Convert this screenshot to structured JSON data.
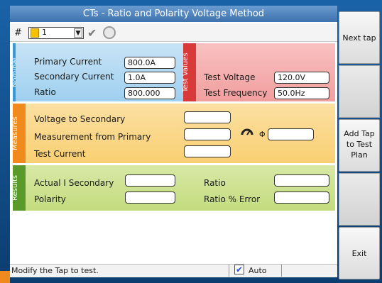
{
  "window": {
    "title": "CTs - Ratio and Polarity Voltage Method"
  },
  "toolbar": {
    "hash": "#",
    "tap_number": "1",
    "check_icon": "checkmark-icon",
    "refresh_icon": "circle-icon"
  },
  "nominal": {
    "tab": "Nominal",
    "primary_current_label": "Primary Current",
    "primary_current_value": "800.0A",
    "secondary_current_label": "Secondary Current",
    "secondary_current_value": "1.0A",
    "ratio_label": "Ratio",
    "ratio_value": "800.000"
  },
  "test_values": {
    "tab": "Test Values",
    "voltage_label": "Test Voltage",
    "voltage_value": "120.0V",
    "frequency_label": "Test Frequency",
    "frequency_value": "50.0Hz"
  },
  "measures": {
    "tab": "Measures",
    "voltage_to_secondary_label": "Voltage to Secondary",
    "measurement_from_primary_label": "Measurement from Primary",
    "test_current_label": "Test Current",
    "phi_label": "Φ"
  },
  "results": {
    "tab": "Results",
    "actual_i_secondary_label": "Actual I Secondary",
    "polarity_label": "Polarity",
    "ratio_label": "Ratio",
    "ratio_error_label": "Ratio % Error"
  },
  "side_buttons": {
    "next_tap": "Next tap",
    "add_tap_1": "Add Tap",
    "add_tap_2": "to Test",
    "add_tap_3": "Plan",
    "exit": "Exit"
  },
  "status": {
    "message": "Modify the Tap to test.",
    "auto_label": "Auto",
    "auto_checked": true
  }
}
